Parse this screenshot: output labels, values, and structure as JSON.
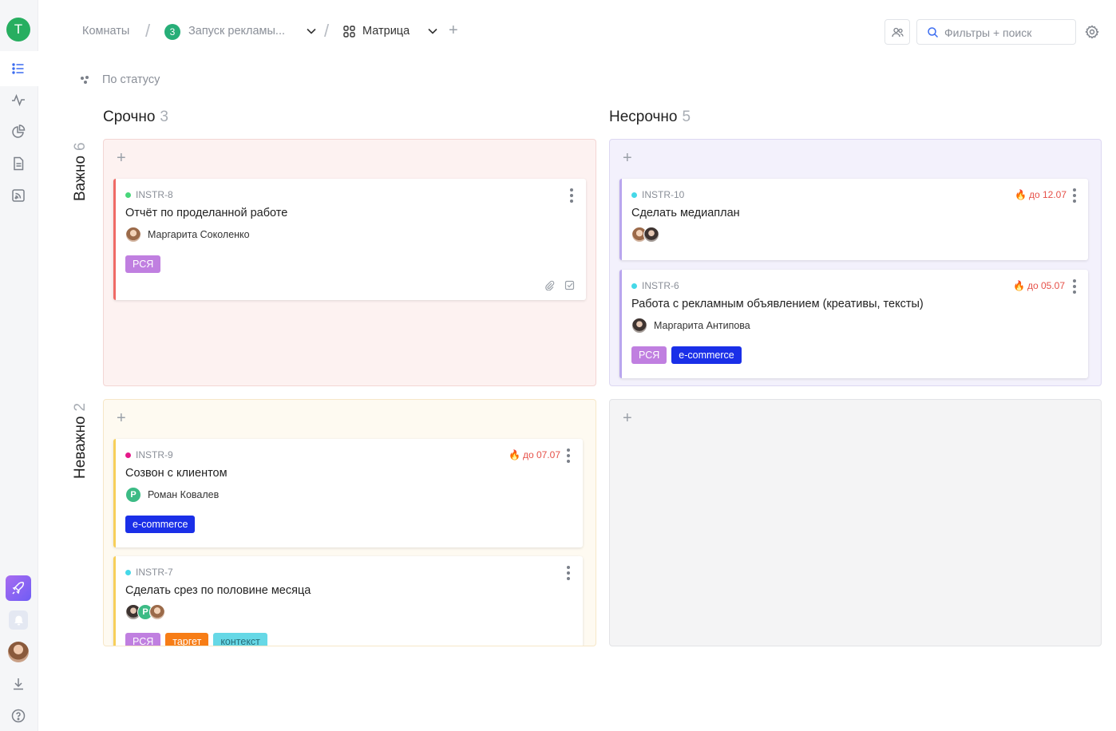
{
  "sidebar": {
    "workspace_letter": "T",
    "icons": [
      "list-icon",
      "activity-icon",
      "pie-chart-icon",
      "document-icon",
      "feed-icon",
      "rocket-icon",
      "bell-icon",
      "avatar",
      "download-icon",
      "help-icon"
    ]
  },
  "breadcrumb": {
    "rooms": "Комнаты",
    "project_badge": "3",
    "project": "Запуск рекламы...",
    "view": "Матрица"
  },
  "toolbar": {
    "search_placeholder": "Фильтры + поиск"
  },
  "groupby": {
    "label": "По статусу"
  },
  "columns": [
    {
      "title": "Срочно",
      "count": "3"
    },
    {
      "title": "Несрочно",
      "count": "5"
    }
  ],
  "rows": [
    {
      "title": "Важно",
      "count": "6"
    },
    {
      "title": "Неважно",
      "count": "2"
    }
  ],
  "cards": {
    "c1": {
      "id": "INSTR-8",
      "status_color": "#48d67a",
      "title": "Отчёт по проделанной работе",
      "assignee": "Маргарита Соколенко",
      "tags": [
        "РСЯ"
      ]
    },
    "c2": {
      "id": "INSTR-10",
      "status_color": "#45d8e8",
      "title": "Сделать медиаплан",
      "deadline": "до 12.07"
    },
    "c3": {
      "id": "INSTR-6",
      "status_color": "#45d8e8",
      "title": "Работа с рекламным объявлением (креативы, тексты)",
      "assignee": "Маргарита Антипова",
      "deadline": "до 05.07",
      "tags": [
        "РСЯ",
        "e-commerce"
      ]
    },
    "c4": {
      "id": "INSTR-9",
      "status_color": "#e5198a",
      "title": "Созвон с клиентом",
      "assignee": "Роман Ковалев",
      "assignee_initial": "Р",
      "deadline": "до 07.07",
      "tags": [
        "e-commerce"
      ]
    },
    "c5": {
      "id": "INSTR-7",
      "status_color": "#45d8e8",
      "title": "Сделать срез по половине месяца",
      "assignee_initial": "Р",
      "tags": [
        "РСЯ",
        "таргет",
        "контекст"
      ]
    }
  },
  "colors": {
    "urgent_important_border": "#ef6a66",
    "not_urgent_important_border": "#b9a6ee",
    "urgent_unimportant_border": "#f7cf5a"
  }
}
